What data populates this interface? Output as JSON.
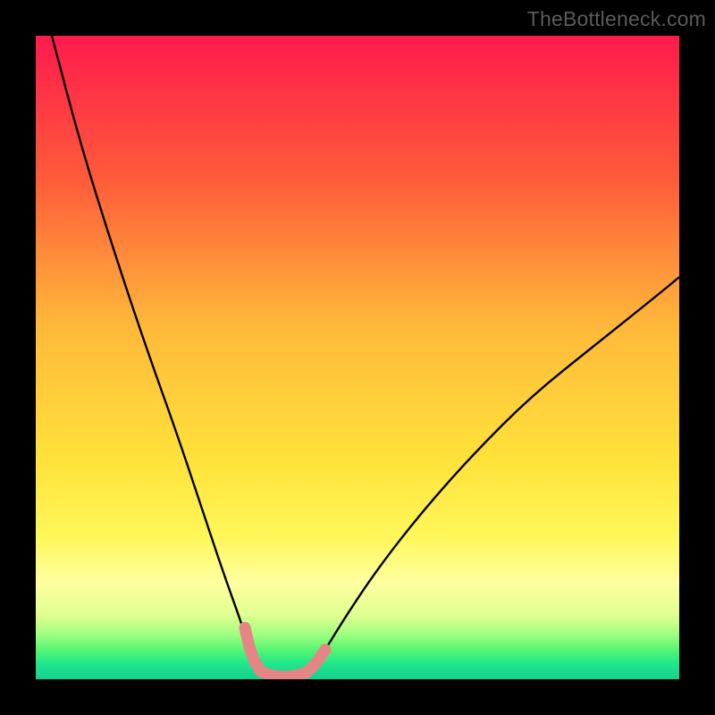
{
  "watermark": "TheBottleneck.com",
  "chart_data": {
    "type": "line",
    "title": "",
    "xlabel": "",
    "ylabel": "",
    "xlim": [
      0,
      100
    ],
    "ylim": [
      0,
      100
    ],
    "gradient_stops": [
      {
        "offset": 0,
        "color": "#ff1a4d"
      },
      {
        "offset": 0.22,
        "color": "#ff5a3a"
      },
      {
        "offset": 0.45,
        "color": "#ffb83a"
      },
      {
        "offset": 0.66,
        "color": "#ffe23a"
      },
      {
        "offset": 0.78,
        "color": "#fff75a"
      },
      {
        "offset": 0.85,
        "color": "#ffffa0"
      },
      {
        "offset": 0.9,
        "color": "#e0ff90"
      },
      {
        "offset": 0.93,
        "color": "#a0ff80"
      },
      {
        "offset": 0.955,
        "color": "#55f573"
      },
      {
        "offset": 0.975,
        "color": "#20e88a"
      },
      {
        "offset": 1.0,
        "color": "#15d090"
      }
    ],
    "series": [
      {
        "name": "left-curve",
        "x": [
          2.5,
          7,
          12,
          17,
          22,
          26,
          29,
          31.5,
          33.2,
          34.0,
          35.0,
          37.0,
          40.0
        ],
        "y": [
          100,
          83,
          67,
          52,
          38,
          26,
          17,
          10,
          5,
          2.8,
          1.2,
          0.4,
          0.4
        ]
      },
      {
        "name": "right-curve",
        "x": [
          40,
          42,
          43.5,
          45,
          48,
          53,
          60,
          68,
          77,
          87,
          97,
          100
        ],
        "y": [
          0.4,
          1.0,
          2.4,
          4.6,
          9.5,
          17,
          26,
          35,
          44,
          52,
          60,
          62.5
        ]
      }
    ],
    "markers": {
      "name": "salmon-markers",
      "color": "#e58585",
      "points": [
        {
          "x": 32.5,
          "y": 8.0
        },
        {
          "x": 33.2,
          "y": 5.0
        },
        {
          "x": 34.0,
          "y": 2.8
        },
        {
          "x": 35.0,
          "y": 1.2
        },
        {
          "x": 37.0,
          "y": 0.5
        },
        {
          "x": 39.0,
          "y": 0.4
        },
        {
          "x": 40.5,
          "y": 0.6
        },
        {
          "x": 42.0,
          "y": 1.0
        },
        {
          "x": 43.5,
          "y": 2.4
        },
        {
          "x": 45.0,
          "y": 4.6
        }
      ]
    }
  }
}
